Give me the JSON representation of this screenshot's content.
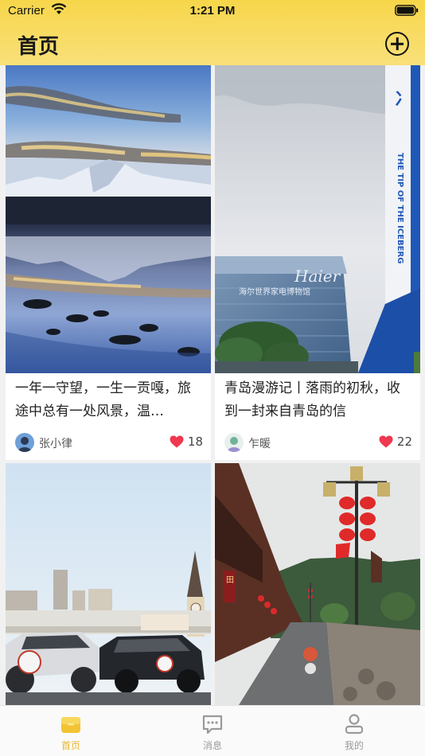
{
  "status_bar": {
    "carrier": "Carrier",
    "time": "1:21 PM"
  },
  "header": {
    "title": "首页",
    "add_icon": "plus-circle-icon"
  },
  "feed": {
    "cards": [
      {
        "image": "mountain-lake-reflection",
        "title": "一年一守望，一生一贡嘎，旅途中总有一处风景，温…",
        "author": "张小律",
        "likes": "18"
      },
      {
        "image": "haier-building-cloudy-sky",
        "title": "青岛漫游记丨落雨的初秋，收到一封来自青岛的信",
        "author": "乍暖",
        "likes": "22"
      },
      {
        "image": "city-cars-clock-tower",
        "title": "",
        "author": "",
        "likes": ""
      },
      {
        "image": "old-street-red-lanterns",
        "title": "",
        "author": "",
        "likes": ""
      }
    ]
  },
  "tabbar": {
    "tabs": [
      {
        "label": "首页",
        "icon": "home-icon",
        "active": true
      },
      {
        "label": "消息",
        "icon": "message-icon",
        "active": false
      },
      {
        "label": "我的",
        "icon": "profile-icon",
        "active": false
      }
    ]
  },
  "colors": {
    "header_gradient_top": "#f7d64a",
    "accent": "#e9b628",
    "like_heart": "#f0384f"
  }
}
